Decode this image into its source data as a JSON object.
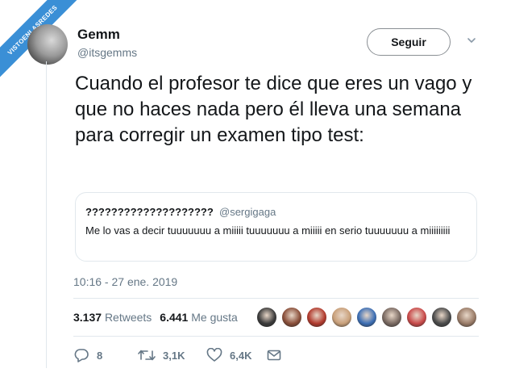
{
  "watermark": {
    "text": "VISTOENLASREDES"
  },
  "author": {
    "name": "Gemm",
    "handle": "@itsgemms",
    "follow_label": "Seguir"
  },
  "tweet": {
    "text": "Cuando el profesor te dice que eres un vago y que no haces nada pero él lleva una semana para corregir un examen tipo test:"
  },
  "quote": {
    "name": "????????????????????",
    "handle": "@sergigaga",
    "text": "Me lo vas a decir tuuuuuuu a miiiii tuuuuuuu a miiiii en serio tuuuuuuu a miiiiiiiii"
  },
  "timestamp": "10:16 - 27 ene. 2019",
  "stats": {
    "retweets_count": "3.137",
    "retweets_label": "Retweets",
    "likes_count": "6.441",
    "likes_label": "Me gusta"
  },
  "actions": {
    "replies": "8",
    "retweets": "3,1K",
    "likes": "6,4K"
  },
  "icons": {
    "more": "chevron-down-icon",
    "reply": "reply-icon",
    "retweet": "retweet-icon",
    "like": "heart-icon",
    "dm": "envelope-icon"
  },
  "colors": {
    "accent": "#1da1f2",
    "banner": "#3a8fd6",
    "muted": "#657786",
    "text": "#14171a",
    "border": "#e1e8ed"
  },
  "likers": [
    {
      "color": "#3b3b3b"
    },
    {
      "color": "#8a4f3a"
    },
    {
      "color": "#b23b2e"
    },
    {
      "color": "#c9a07a"
    },
    {
      "color": "#3d6fb5"
    },
    {
      "color": "#7a6a62"
    },
    {
      "color": "#c94a4a"
    },
    {
      "color": "#4b4b4b"
    },
    {
      "color": "#9a7c68"
    }
  ]
}
